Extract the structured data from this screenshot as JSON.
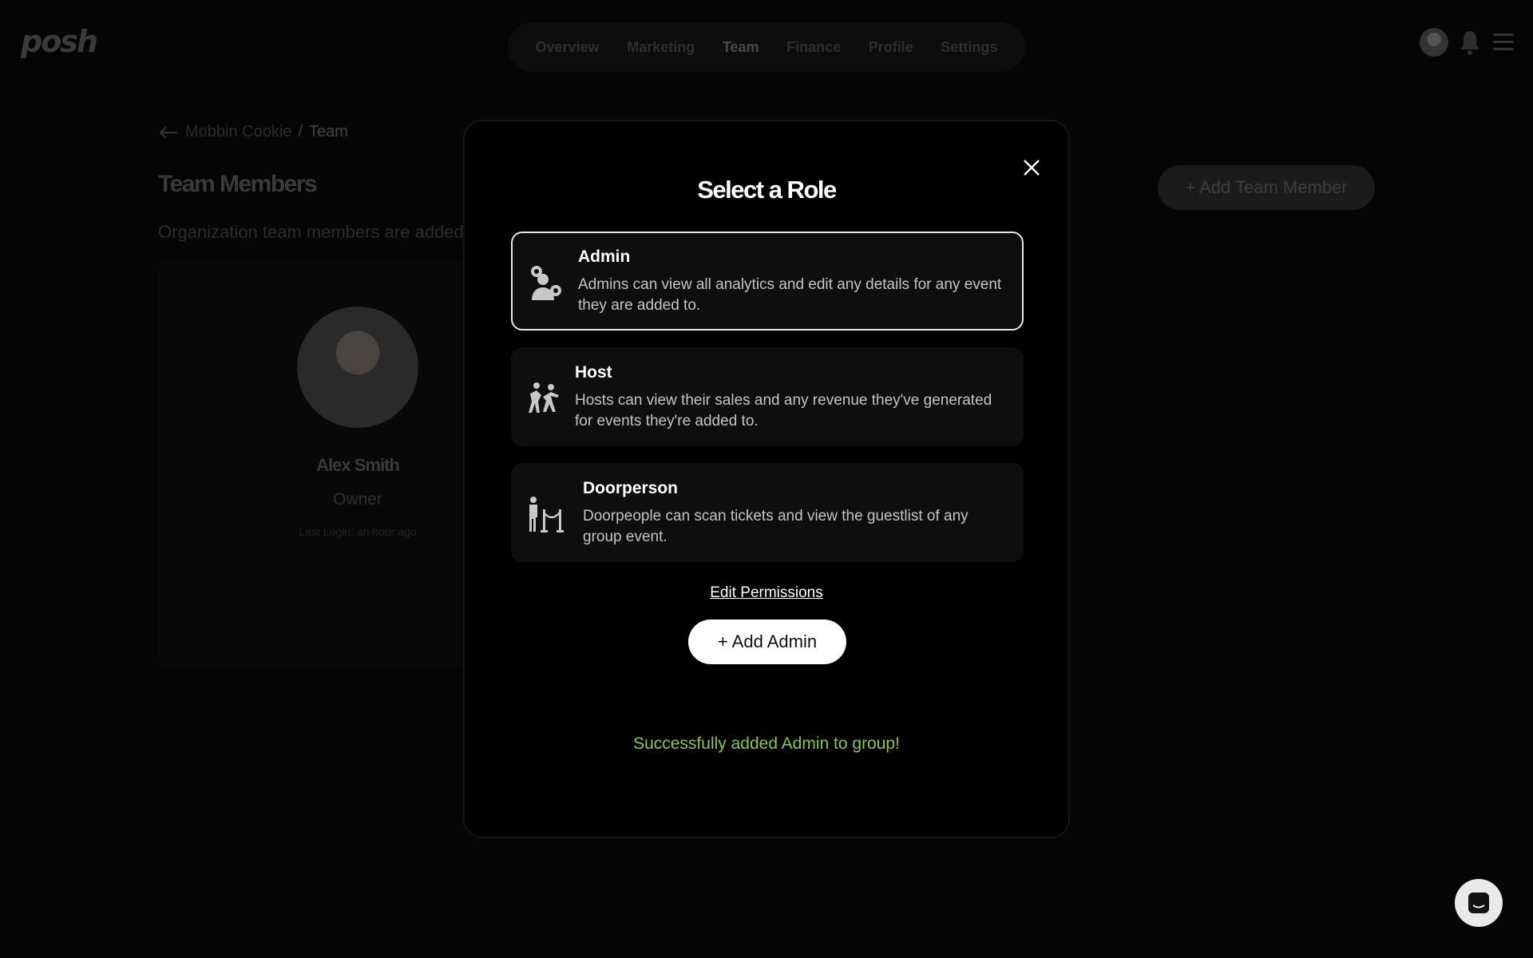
{
  "app": {
    "logo": "posh"
  },
  "nav": {
    "items": [
      {
        "label": "Overview",
        "active": false
      },
      {
        "label": "Marketing",
        "active": false
      },
      {
        "label": "Team",
        "active": true
      },
      {
        "label": "Finance",
        "active": false
      },
      {
        "label": "Profile",
        "active": false
      },
      {
        "label": "Settings",
        "active": false
      }
    ]
  },
  "breadcrumb": {
    "org": "Mobbin Cookie",
    "separator": "/",
    "current": "Team"
  },
  "team": {
    "title": "Team Members",
    "description": "Organization team members are added t",
    "add_button": "+ Add Team Member"
  },
  "member": {
    "name": "Alex Smith",
    "role": "Owner",
    "last_login": "Last Login: an hour ago"
  },
  "modal": {
    "title": "Select a Role",
    "roles": [
      {
        "name": "Admin",
        "description": "Admins can view all analytics and edit any details for any event they are added to.",
        "icon": "admin-gear-person-icon",
        "selected": true
      },
      {
        "name": "Host",
        "description": "Hosts can view their sales and any revenue they've generated for events they're added to.",
        "icon": "dancing-people-icon",
        "selected": false
      },
      {
        "name": "Doorperson",
        "description": "Doorpeople can scan tickets and view the guestlist of any group event.",
        "icon": "doorman-rope-icon",
        "selected": false
      }
    ],
    "edit_permissions": "Edit Permissions",
    "add_button": "+ Add Admin",
    "success_message": "Successfully added Admin to group!"
  },
  "colors": {
    "success": "#84c94f",
    "selected_border": "#e6e6e6",
    "card_bg": "#0e0e0e"
  }
}
